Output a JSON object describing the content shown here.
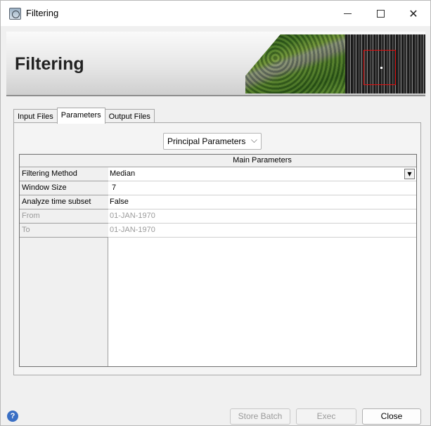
{
  "window": {
    "title": "Filtering",
    "controls": {
      "minimize_icon": "minimize-icon",
      "maximize_icon": "maximize-icon",
      "close_glyph": "✕"
    }
  },
  "banner": {
    "title": "Filtering"
  },
  "tabs": [
    {
      "label": "Input Files",
      "active": false
    },
    {
      "label": "Parameters",
      "active": true
    },
    {
      "label": "Output Files",
      "active": false
    }
  ],
  "parameters": {
    "group_select": {
      "value": "Principal Parameters",
      "chevron": "⌵"
    },
    "table": {
      "column_header": "Main Parameters",
      "rows": [
        {
          "label": "Filtering Method",
          "value": "Median",
          "combo_arrow": "▼",
          "enabled": true
        },
        {
          "label": "Window Size",
          "value": "7",
          "enabled": true
        },
        {
          "label": "Analyze time subset",
          "value": "False",
          "enabled": true
        },
        {
          "label": "From",
          "value": "01-JAN-1970",
          "enabled": false
        },
        {
          "label": "To",
          "value": "01-JAN-1970",
          "enabled": false
        }
      ]
    }
  },
  "footer": {
    "help_glyph": "?",
    "buttons": {
      "store_batch": "Store Batch",
      "exec": "Exec",
      "close": "Close"
    }
  }
}
